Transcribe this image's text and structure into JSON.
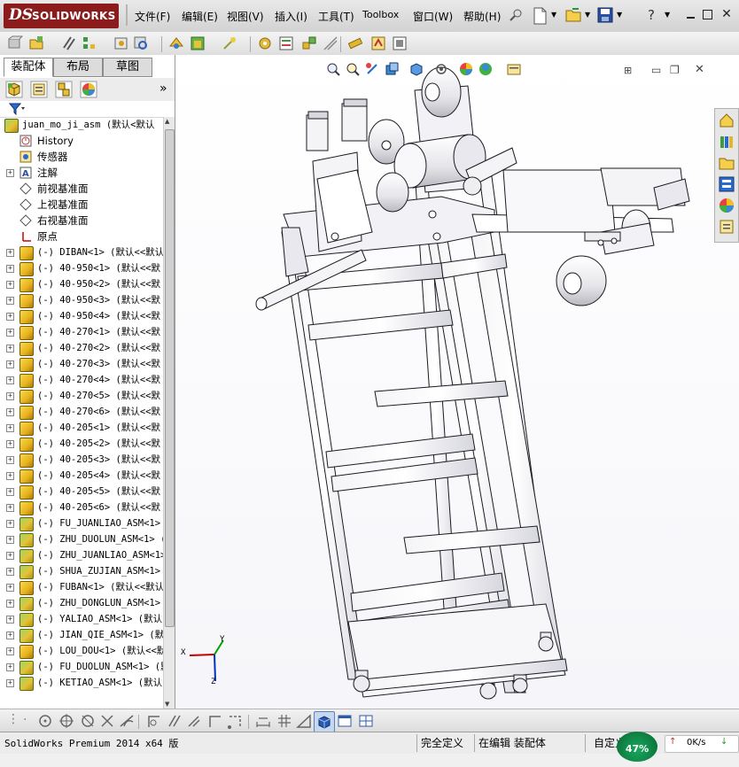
{
  "app": {
    "logo_ds": "DS",
    "logo_text": "SOLIDWORKS"
  },
  "menu": {
    "items": [
      "文件(F)",
      "编辑(E)",
      "视图(V)",
      "插入(I)",
      "工具(T)",
      "Toolbox",
      "窗口(W)",
      "帮助(H)"
    ],
    "help_symbol": "?"
  },
  "panel": {
    "tabs": [
      "装配体",
      "布局",
      "草图"
    ],
    "expand_label": "»"
  },
  "tree": {
    "root": "juan_mo_ji_asm  (默认<默认",
    "items": [
      {
        "label": "History",
        "icon": "history-icon",
        "expand": false
      },
      {
        "label": "传感器",
        "icon": "sensor-icon",
        "expand": false
      },
      {
        "label": "注解",
        "icon": "annotation-icon",
        "expand": true
      },
      {
        "label": "前视基准面",
        "icon": "plane-icon",
        "expand": false
      },
      {
        "label": "上视基准面",
        "icon": "plane-icon",
        "expand": false
      },
      {
        "label": "右视基准面",
        "icon": "plane-icon",
        "expand": false
      },
      {
        "label": "原点",
        "icon": "origin-icon",
        "expand": false
      },
      {
        "label": "(-) DIBAN<1> (默认<<默认",
        "icon": "part-icon",
        "expand": true
      },
      {
        "label": "(-) 40-950<1> (默认<<默",
        "icon": "part-icon",
        "expand": true
      },
      {
        "label": "(-) 40-950<2> (默认<<默",
        "icon": "part-icon",
        "expand": true
      },
      {
        "label": "(-) 40-950<3> (默认<<默",
        "icon": "part-icon",
        "expand": true
      },
      {
        "label": "(-) 40-950<4> (默认<<默",
        "icon": "part-icon",
        "expand": true
      },
      {
        "label": "(-) 40-270<1> (默认<<默",
        "icon": "part-icon",
        "expand": true
      },
      {
        "label": "(-) 40-270<2> (默认<<默",
        "icon": "part-icon",
        "expand": true
      },
      {
        "label": "(-) 40-270<3> (默认<<默",
        "icon": "part-icon",
        "expand": true
      },
      {
        "label": "(-) 40-270<4> (默认<<默",
        "icon": "part-icon",
        "expand": true
      },
      {
        "label": "(-) 40-270<5> (默认<<默",
        "icon": "part-icon",
        "expand": true
      },
      {
        "label": "(-) 40-270<6> (默认<<默",
        "icon": "part-icon",
        "expand": true
      },
      {
        "label": "(-) 40-205<1> (默认<<默",
        "icon": "part-icon",
        "expand": true
      },
      {
        "label": "(-) 40-205<2> (默认<<默",
        "icon": "part-icon",
        "expand": true
      },
      {
        "label": "(-) 40-205<3> (默认<<默",
        "icon": "part-icon",
        "expand": true
      },
      {
        "label": "(-) 40-205<4> (默认<<默",
        "icon": "part-icon",
        "expand": true
      },
      {
        "label": "(-) 40-205<5> (默认<<默",
        "icon": "part-icon",
        "expand": true
      },
      {
        "label": "(-) 40-205<6> (默认<<默",
        "icon": "part-icon",
        "expand": true
      },
      {
        "label": "(-) FU_JUANLIAO_ASM<1>",
        "icon": "assembly-icon",
        "expand": true
      },
      {
        "label": "(-) ZHU_DUOLUN_ASM<1> (",
        "icon": "assembly-icon",
        "expand": true
      },
      {
        "label": "(-) ZHU_JUANLIAO_ASM<1>",
        "icon": "assembly-icon",
        "expand": true
      },
      {
        "label": "(-) SHUA_ZUJIAN_ASM<1>",
        "icon": "assembly-icon",
        "expand": true
      },
      {
        "label": "(-) FUBAN<1> (默认<<默认",
        "icon": "part-icon",
        "expand": true
      },
      {
        "label": "(-) ZHU_DONGLUN_ASM<1>",
        "icon": "assembly-icon",
        "expand": true
      },
      {
        "label": "(-) YALIAO_ASM<1> (默认",
        "icon": "assembly-icon",
        "expand": true
      },
      {
        "label": "(-) JIAN_QIE_ASM<1> (默",
        "icon": "assembly-icon",
        "expand": true
      },
      {
        "label": "(-) LOU_DOU<1> (默认<<默",
        "icon": "part-icon",
        "expand": true
      },
      {
        "label": "(-) FU_DUOLUN_ASM<1> (默",
        "icon": "assembly-icon",
        "expand": true
      },
      {
        "label": "(-) KETIAO_ASM<1> (默认",
        "icon": "assembly-icon",
        "expand": true
      }
    ]
  },
  "triad": {
    "x": "X",
    "y": "Y",
    "z": "Z"
  },
  "status": {
    "product": "SolidWorks Premium 2014 x64 版",
    "definition": "完全定义",
    "editing": "在编辑 装配体",
    "custom": "自定义",
    "cpu_percent": "47%",
    "net_speed": "0K/s"
  },
  "colors": {
    "accent": "#8c1c1c",
    "status_green": "#0d7a3e",
    "part_yellow": "#e6b21c"
  }
}
